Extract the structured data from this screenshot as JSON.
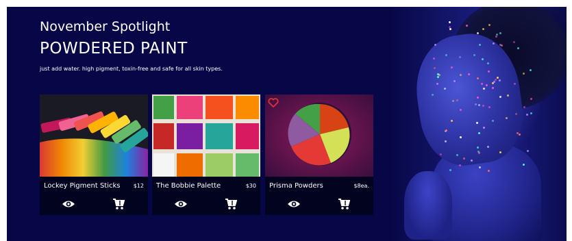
{
  "hero": {
    "eyebrow": "November Spotlight",
    "headline": "POWDERED PAINT",
    "tagline": "just add water. high pigment, toxin-free and safe for all skin types."
  },
  "products": [
    {
      "name": "Lockey Pigment Sticks",
      "price": "$12",
      "image": "rainbow-pigment-sticks-image",
      "favorite": false
    },
    {
      "name": "The Bobbie Palette",
      "price": "$30",
      "image": "color-palette-tray-image",
      "favorite": false
    },
    {
      "name": "Prisma Powders",
      "price": "$8ea.",
      "image": "colored-powder-dish-image",
      "favorite": true
    }
  ],
  "icons": {
    "view": "eye-icon",
    "cart": "cart-icon",
    "favorite": "heart-icon"
  },
  "colors": {
    "background": "#070747",
    "card": "#02031f",
    "text": "#ffffff",
    "favorite": "#e0323c"
  }
}
